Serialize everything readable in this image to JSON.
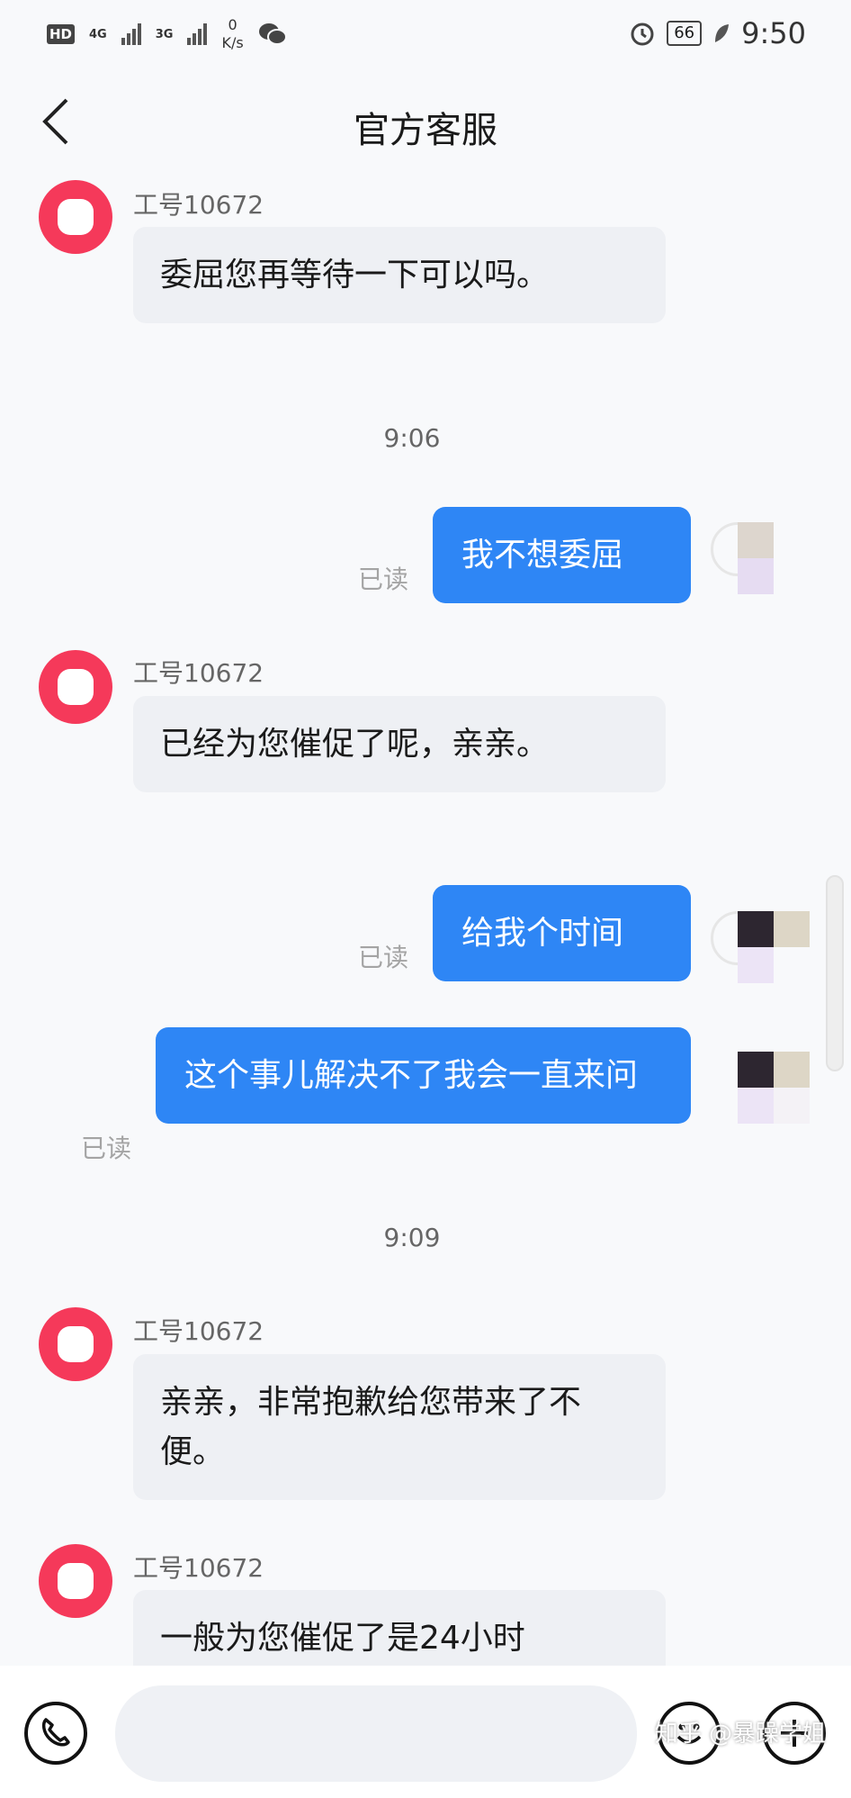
{
  "status_bar": {
    "hd_label": "HD",
    "net1_label": "4G",
    "net2_label": "3G",
    "speed_value": "0",
    "speed_unit": "K/s",
    "battery": "66",
    "time": "9:50"
  },
  "nav": {
    "title": "官方客服"
  },
  "chat": {
    "agent_name": "工号10672",
    "read_label": "已读",
    "messages": [
      {
        "text": "委屈您再等待一下可以吗。"
      },
      {
        "time": "9:06"
      },
      {
        "text": "我不想委屈"
      },
      {
        "text": "已经为您催促了呢，亲亲。"
      },
      {
        "text": "给我个时间"
      },
      {
        "text": "这个事儿解决不了我会一直来问"
      },
      {
        "time": "9:09"
      },
      {
        "text": "亲亲，非常抱歉给您带来了不便。"
      },
      {
        "text": "一般为您催促了是24小时"
      }
    ]
  },
  "bottom": {
    "input_placeholder": "",
    "watermark": "知乎 @暴躁学姐"
  },
  "colors": {
    "accent": "#2e86f5",
    "agent_avatar": "#f5395a",
    "bubble_in": "#eef0f4"
  }
}
